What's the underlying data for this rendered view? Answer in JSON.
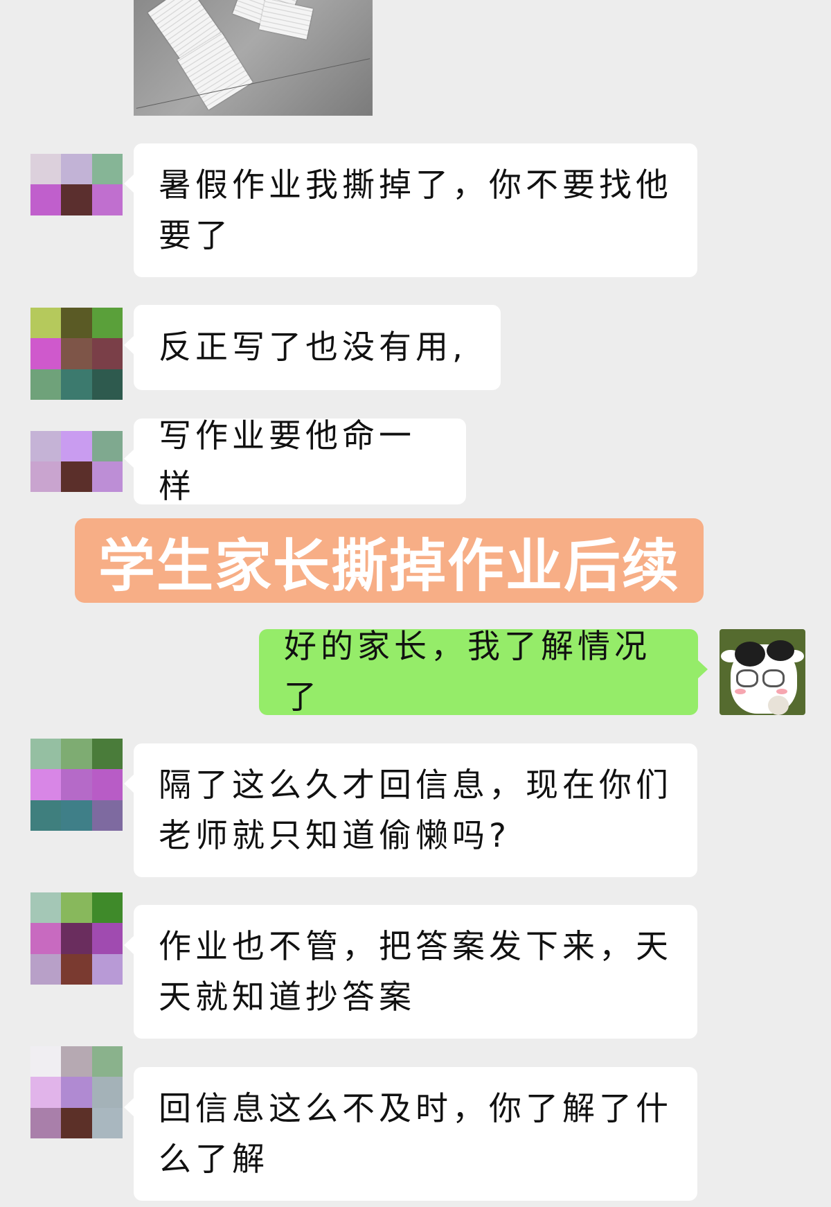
{
  "messages": [
    {
      "id": "m1",
      "sender": "parent",
      "text_lines": [
        "暑假作业我撕掉了，你不要找他",
        "要了"
      ]
    },
    {
      "id": "m2",
      "sender": "parent",
      "text_lines": [
        "反正写了也没有用,"
      ]
    },
    {
      "id": "m3",
      "sender": "parent",
      "text_lines": [
        "写作业要他命一样"
      ]
    },
    {
      "id": "m4",
      "sender": "teacher",
      "text_lines": [
        "好的家长，我了解情况了"
      ]
    },
    {
      "id": "m5",
      "sender": "parent",
      "text_lines": [
        "隔了这么久才回信息，现在你们",
        "老师就只知道偷懒吗?"
      ]
    },
    {
      "id": "m6",
      "sender": "parent",
      "text_lines": [
        "作业也不管，把答案发下来，天",
        "天就知道抄答案"
      ]
    },
    {
      "id": "m7",
      "sender": "parent",
      "text_lines": [
        "回信息这么不及时，你了解了什",
        "么了解"
      ]
    }
  ],
  "overlay_title": "学生家长撕掉作业后续",
  "images": {
    "top_photo": "torn-homework-paper-photo",
    "teacher_avatar": "cartoon-cow-with-glasses-avatar",
    "parent_avatar": "pixelated-mosaic-avatar"
  },
  "colors": {
    "background": "#ededed",
    "received_bubble": "#ffffff",
    "sent_bubble": "#95ec69",
    "banner": "#f7ae86",
    "banner_text": "#ffffff"
  }
}
